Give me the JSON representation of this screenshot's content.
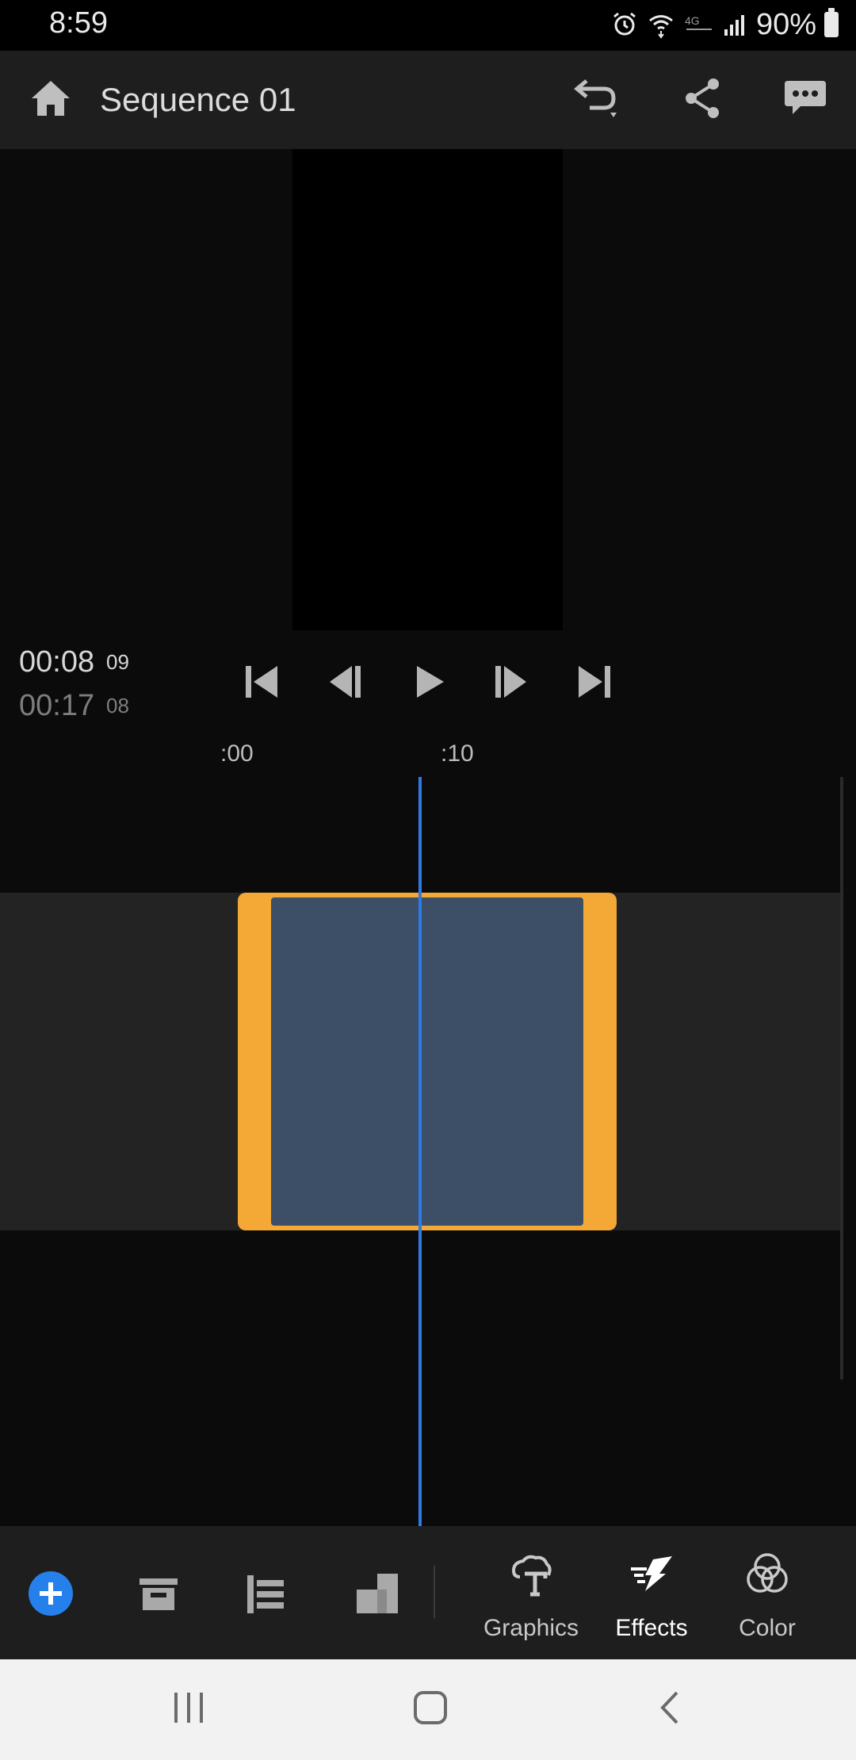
{
  "status_bar": {
    "time": "8:59",
    "battery": "90%"
  },
  "header": {
    "title": "Sequence 01",
    "icons": [
      "home-icon",
      "undo-icon",
      "share-icon",
      "feedback-icon"
    ]
  },
  "timecode": {
    "current": "00:08",
    "current_frames": "09",
    "total": "00:17",
    "total_frames": "08"
  },
  "transport": [
    "skip-to-start-icon",
    "step-back-icon",
    "play-icon",
    "step-forward-icon",
    "skip-to-end-icon"
  ],
  "ruler": {
    "marks": [
      ":00",
      ":10"
    ]
  },
  "toolbar": {
    "add_icon": "add-media-icon",
    "graphics_label": "Graphics",
    "effects_label": "Effects",
    "color_label": "Color"
  },
  "colors": {
    "clip": "#f4a936",
    "clip_inner": "#3c4f67",
    "playhead": "#2f7be6",
    "accent": "#2680eb"
  }
}
